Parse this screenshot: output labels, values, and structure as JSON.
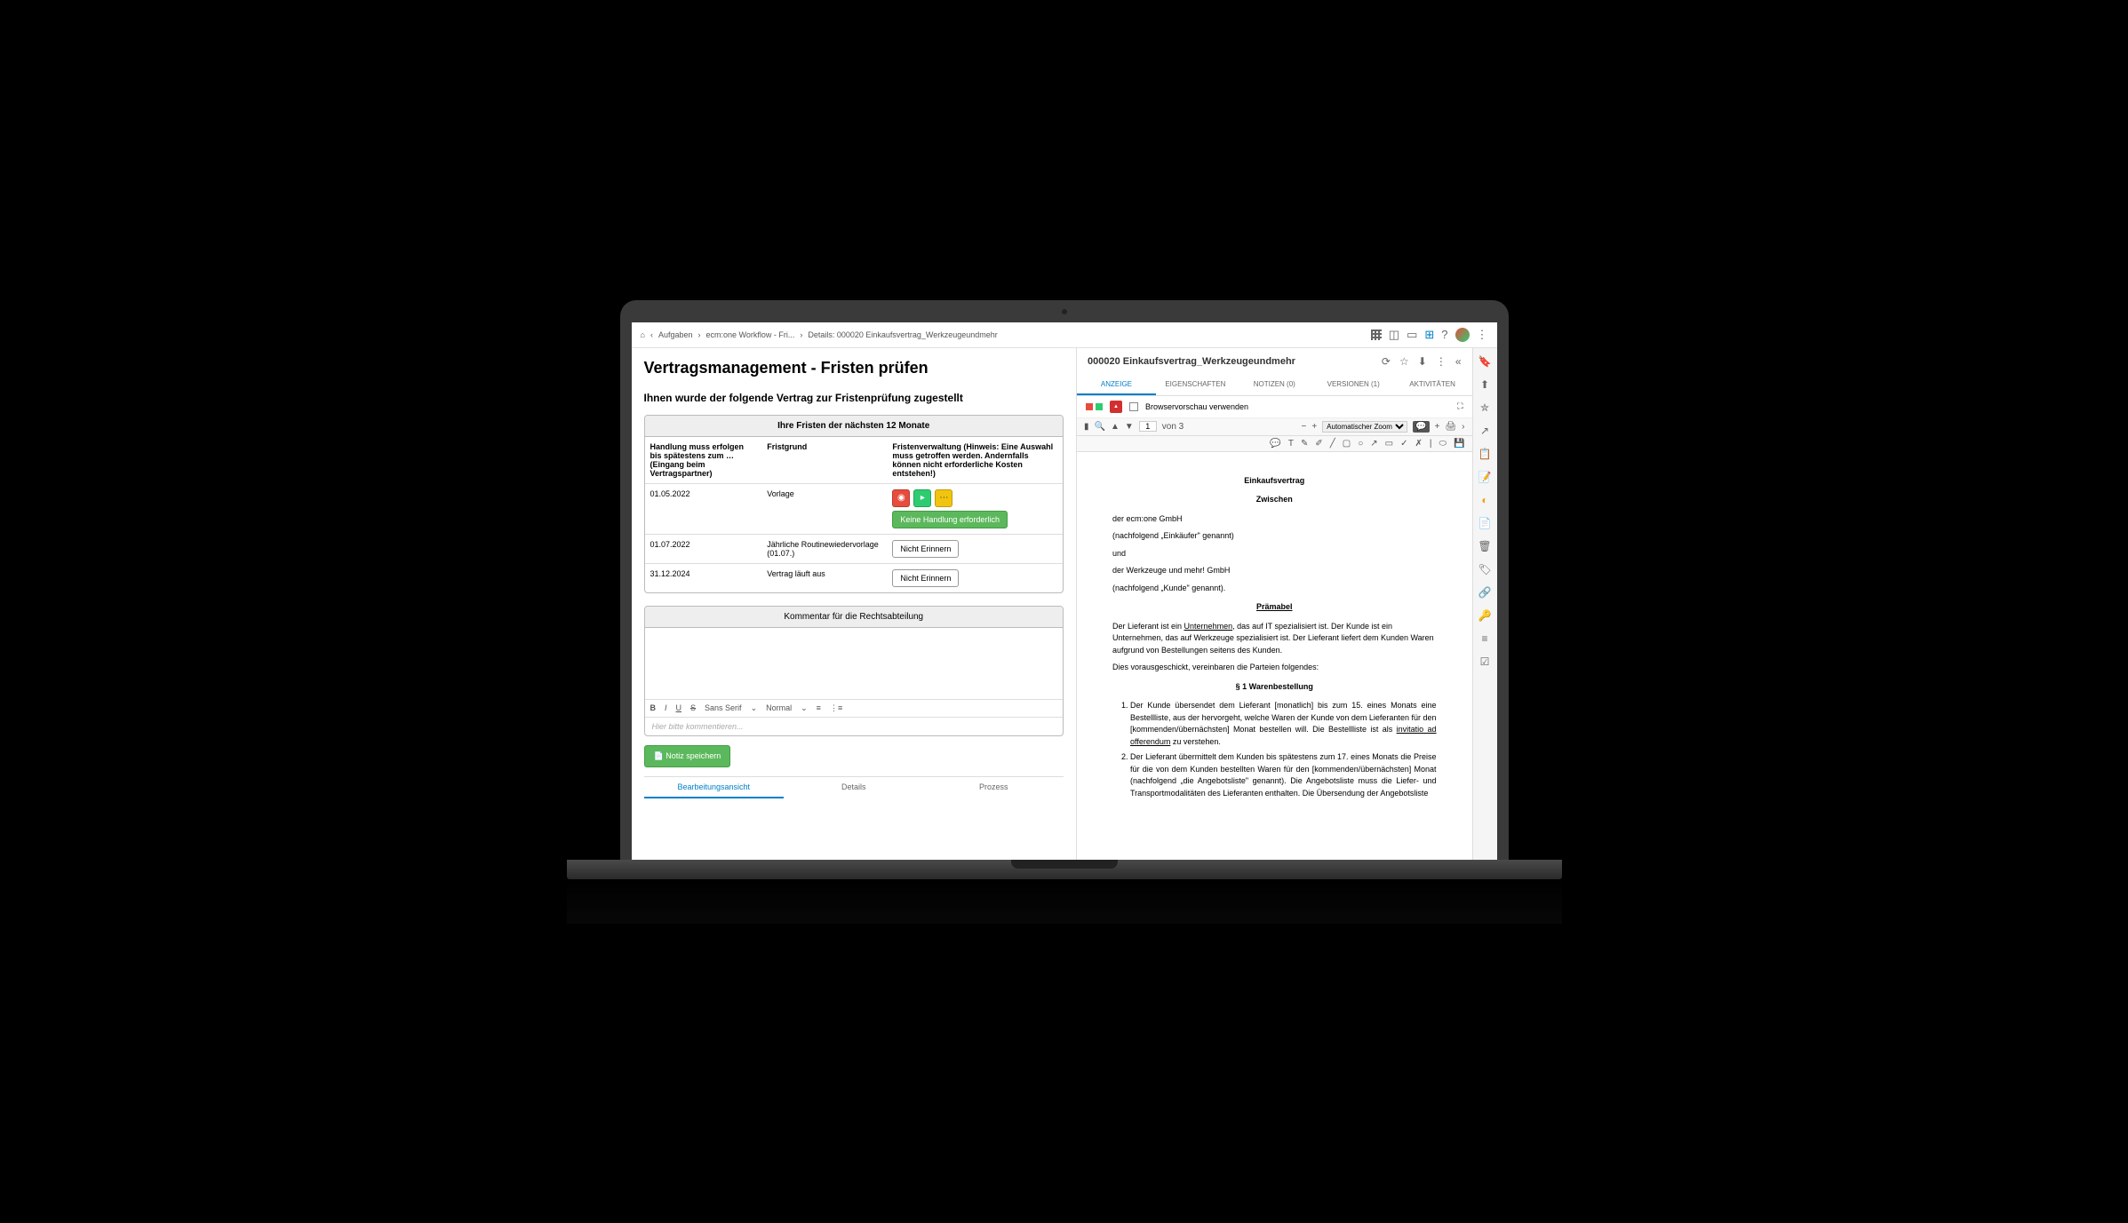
{
  "breadcrumbs": {
    "home": "⌂",
    "items": [
      "Aufgaben",
      "ecm:one Workflow - Fri...",
      "Details: 000020 Einkaufsvertrag_Werkzeugeundmehr"
    ]
  },
  "left": {
    "title": "Vertragsmanagement - Fristen prüfen",
    "subtitle": "Ihnen wurde der folgende Vertrag zur Fristenprüfung zugestellt",
    "tableTitle": "Ihre Fristen der nächsten 12 Monate",
    "headers": {
      "c1": "Handlung muss erfolgen bis spätestens zum … (Eingang beim Vertragspartner)",
      "c2": "Fristgrund",
      "c3": "Fristenverwaltung (Hinweis: Eine Auswahl muss getroffen werden. Andernfalls können nicht erforderliche Kosten entstehen!)"
    },
    "rows": [
      {
        "date": "01.05.2022",
        "reason": "Vorlage",
        "action": "buttons",
        "greenBtn": "Keine Handlung erforderlich"
      },
      {
        "date": "01.07.2022",
        "reason": "Jährliche Routinewiedervorlage (01.07.)",
        "action": "remind",
        "btn": "Nicht Erinnern"
      },
      {
        "date": "31.12.2024",
        "reason": "Vertrag läuft aus",
        "action": "remind",
        "btn": "Nicht Erinnern"
      }
    ],
    "kommentarTitle": "Kommentar für die Rechtsabteilung",
    "toolbar": {
      "font": "Sans Serif",
      "size": "Normal"
    },
    "placeholder": "Hier bitte kommentieren...",
    "saveBtn": "Notiz speichern",
    "bottomTabs": [
      "Bearbeitungsansicht",
      "Details",
      "Prozess"
    ]
  },
  "right": {
    "docTitle": "000020 Einkaufsvertrag_Werkzeugeundmehr",
    "tabs": [
      "ANZEIGE",
      "EIGENSCHAFTEN",
      "NOTIZEN (0)",
      "VERSIONEN (1)",
      "AKTIVITÄTEN"
    ],
    "browserPreview": "Browservorschau verwenden",
    "pageOf": "von 3",
    "pageCurrent": "1",
    "zoom": "Automatischer Zoom",
    "doc": {
      "t1": "Einkaufsvertrag",
      "t2": "Zwischen",
      "p1": "der ecm:one GmbH",
      "p2": "(nachfolgend „Einkäufer\" genannt)",
      "p3": "und",
      "p4": "der Werkzeuge und mehr! GmbH",
      "p5": "(nachfolgend „Kunde\" genannt).",
      "t3": "Prämabel",
      "p6a": "Der Lieferant ist ein ",
      "p6link": "Unternehmen",
      "p6b": ", das auf IT spezialisiert ist. Der Kunde ist ein Unternehmen, das auf Werkzeuge spezialisiert ist. Der Lieferant liefert dem Kunden Waren aufgrund von Bestellungen seitens des Kunden.",
      "p7": "Dies vorausgeschickt, vereinbaren die Parteien folgendes:",
      "t4": "§ 1 Warenbestellung",
      "li1a": "Der Kunde übersendet dem Lieferant [monatlich] bis zum 15. eines Monats eine Bestellliste, aus der hervorgeht, welche Waren der Kunde von dem Lieferanten für den [kommenden/übernächsten] Monat bestellen will. Die Bestellliste ist als ",
      "li1link": "invitatio ad offerendum",
      "li1b": " zu verstehen.",
      "li2": "Der Lieferant übermittelt dem Kunden bis spätestens zum  17. eines Monats die Preise für die von dem Kunden bestellten Waren für den [kommenden/übernächsten] Monat (nachfolgend „die Angebotsliste\" genannt). Die Angebotsliste muss die Liefer- und Transportmodalitäten des Lieferanten enthalten. Die Übersendung der Angebotsliste"
    }
  }
}
